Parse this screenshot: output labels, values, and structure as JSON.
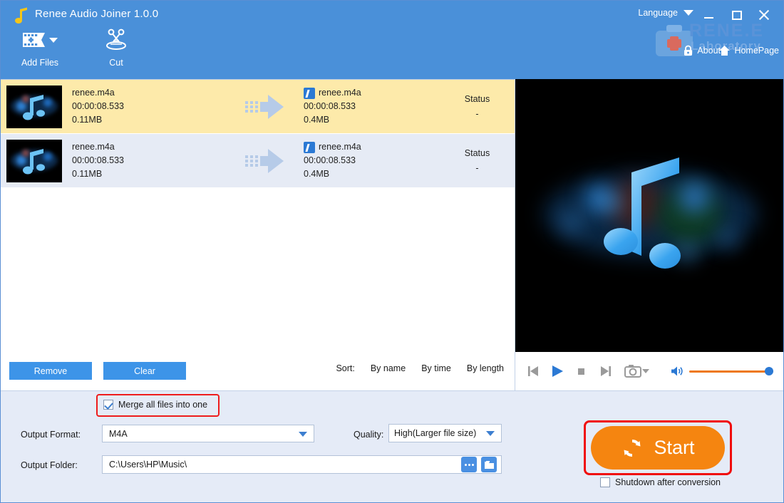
{
  "window": {
    "title": "Renee Audio Joiner 1.0.0",
    "app_icon": "music-note-icon",
    "minimize_label": "Minimize",
    "maximize_label": "Maximize",
    "close_label": "Close"
  },
  "header": {
    "language_label": "Language",
    "language_dropdown_icon": "chevron-down-icon",
    "watermark_brand": "RENE.E",
    "watermark_sub": "Laboratory",
    "watermark_icon": "medical-bag-icon",
    "about_label": "About",
    "about_icon": "lock-icon",
    "homepage_label": "HomePage",
    "homepage_icon": "home-icon"
  },
  "toolbar": {
    "items": [
      {
        "label": "Add Files",
        "icon": "film-strip-plus-icon",
        "has_dropdown": true
      },
      {
        "label": "Cut",
        "icon": "scissors-icon",
        "has_dropdown": false
      }
    ]
  },
  "filelist": {
    "columns": {
      "status_header": "Status"
    },
    "rows": [
      {
        "thumbnail": "music-note-thumbnail",
        "source_name": "renee.m4a",
        "source_duration": "00:00:08.533",
        "source_size": "0.11MB",
        "convert_icon": "arrow-right-icon",
        "output_edit_icon": "edit-pencil-icon",
        "output_name": "renee.m4a",
        "output_duration": "00:00:08.533",
        "output_size": "0.4MB",
        "status_header": "Status",
        "status_value": "-",
        "selected": true
      },
      {
        "thumbnail": "music-note-thumbnail",
        "source_name": "renee.m4a",
        "source_duration": "00:00:08.533",
        "source_size": "0.11MB",
        "convert_icon": "arrow-right-icon",
        "output_edit_icon": "edit-pencil-icon",
        "output_name": "renee.m4a",
        "output_duration": "00:00:08.533",
        "output_size": "0.4MB",
        "status_header": "Status",
        "status_value": "-",
        "selected": false
      }
    ]
  },
  "listbar": {
    "remove_label": "Remove",
    "clear_label": "Clear",
    "sort_label": "Sort:",
    "sort_by_name": "By name",
    "sort_by_time": "By time",
    "sort_by_length": "By length"
  },
  "player": {
    "previous_icon": "skip-previous-icon",
    "play_icon": "play-icon",
    "stop_icon": "stop-icon",
    "next_icon": "skip-next-icon",
    "snapshot_icon": "camera-icon",
    "snapshot_dropdown_icon": "chevron-down-icon",
    "volume_icon": "volume-high-icon",
    "volume_value": 100
  },
  "settings": {
    "merge_label": "Merge all files into one",
    "merge_checked": true,
    "output_format_label": "Output Format:",
    "output_format_value": "M4A",
    "quality_label": "Quality:",
    "quality_value": "High(Larger file size)",
    "output_folder_label": "Output Folder:",
    "output_folder_value": "C:\\Users\\HP\\Music\\",
    "browse_icon": "ellipsis-icon",
    "open_folder_icon": "folder-icon"
  },
  "action": {
    "start_label": "Start",
    "start_icon": "refresh-icon",
    "shutdown_label": "Shutdown after conversion",
    "shutdown_checked": false
  },
  "colors": {
    "titlebar_blue": "#4a90d9",
    "accent_blue": "#3d94e8",
    "start_orange": "#f58510",
    "highlight_red": "#ee1c1c",
    "selected_row": "#fdeaaa",
    "alt_row": "#e6ebf5",
    "panel_bg": "#e5ebf7"
  }
}
